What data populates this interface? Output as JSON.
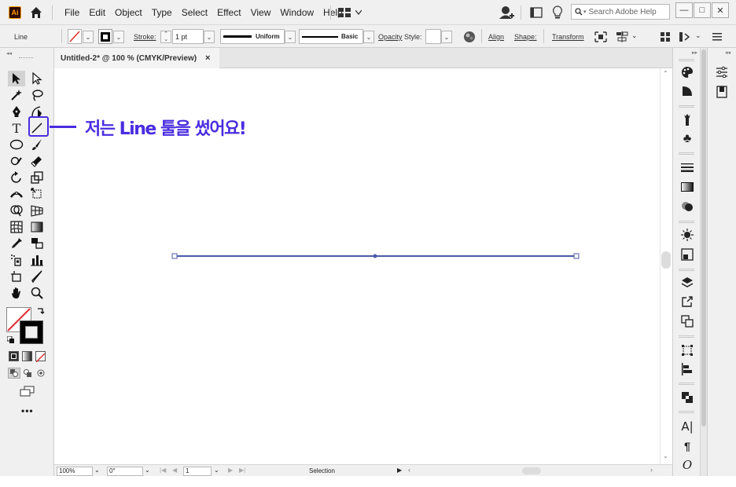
{
  "app": {
    "logo": "Ai"
  },
  "menu": [
    "File",
    "Edit",
    "Object",
    "Type",
    "Select",
    "Effect",
    "View",
    "Window",
    "Help"
  ],
  "search": {
    "placeholder": "Search Adobe Help"
  },
  "window_controls": {
    "minimize": "—",
    "maximize": "□",
    "close": "✕"
  },
  "control_bar": {
    "object_type": "Line",
    "stroke_label": "Stroke:",
    "stroke_weight": "1 pt",
    "profile": "Uniform",
    "brush": "Basic",
    "opacity_label": "Opacity",
    "style_label": "Style:",
    "align_label": "Align",
    "shape_label": "Shape:",
    "transform_label": "Transform"
  },
  "document": {
    "tab_title": "Untitled-2* @ 100 % (CMYK/Preview)",
    "close": "×"
  },
  "status_bar": {
    "zoom": "100%",
    "rotation": "0°",
    "artboard": "1",
    "tool": "Selection"
  },
  "annotation": {
    "text": "저는 Line 툴을 썼어요!"
  },
  "colors": {
    "accent": "#4a2de0",
    "line": "#4b5aa8",
    "logo_bg": "#2d0a00",
    "logo_fg": "#ff9a00"
  }
}
